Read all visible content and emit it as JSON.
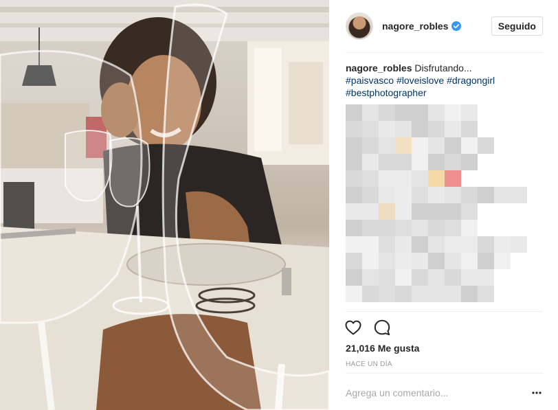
{
  "post": {
    "image_alt": "",
    "author": {
      "username": "nagore_robles",
      "verified": true
    },
    "follow_label": "Seguido",
    "caption": {
      "username": "nagore_robles",
      "text": "Disfrutando...",
      "hashtags": [
        "#paisvasco",
        "#loveislove",
        "#dragongirl",
        "#bestphotographer"
      ]
    },
    "likes_text": "21,016 Me gusta",
    "timestamp": "HACE UN DÍA",
    "comment_placeholder": "Agrega un comentario...",
    "icons": {
      "like": "heart-icon",
      "comment": "comment-icon",
      "more": "more-options-icon",
      "verified": "verified-badge-icon"
    }
  },
  "colors": {
    "text": "#262626",
    "hashtag": "#003569",
    "muted": "#999999",
    "verified": "#3897f0",
    "border": "#dbdbdb"
  }
}
